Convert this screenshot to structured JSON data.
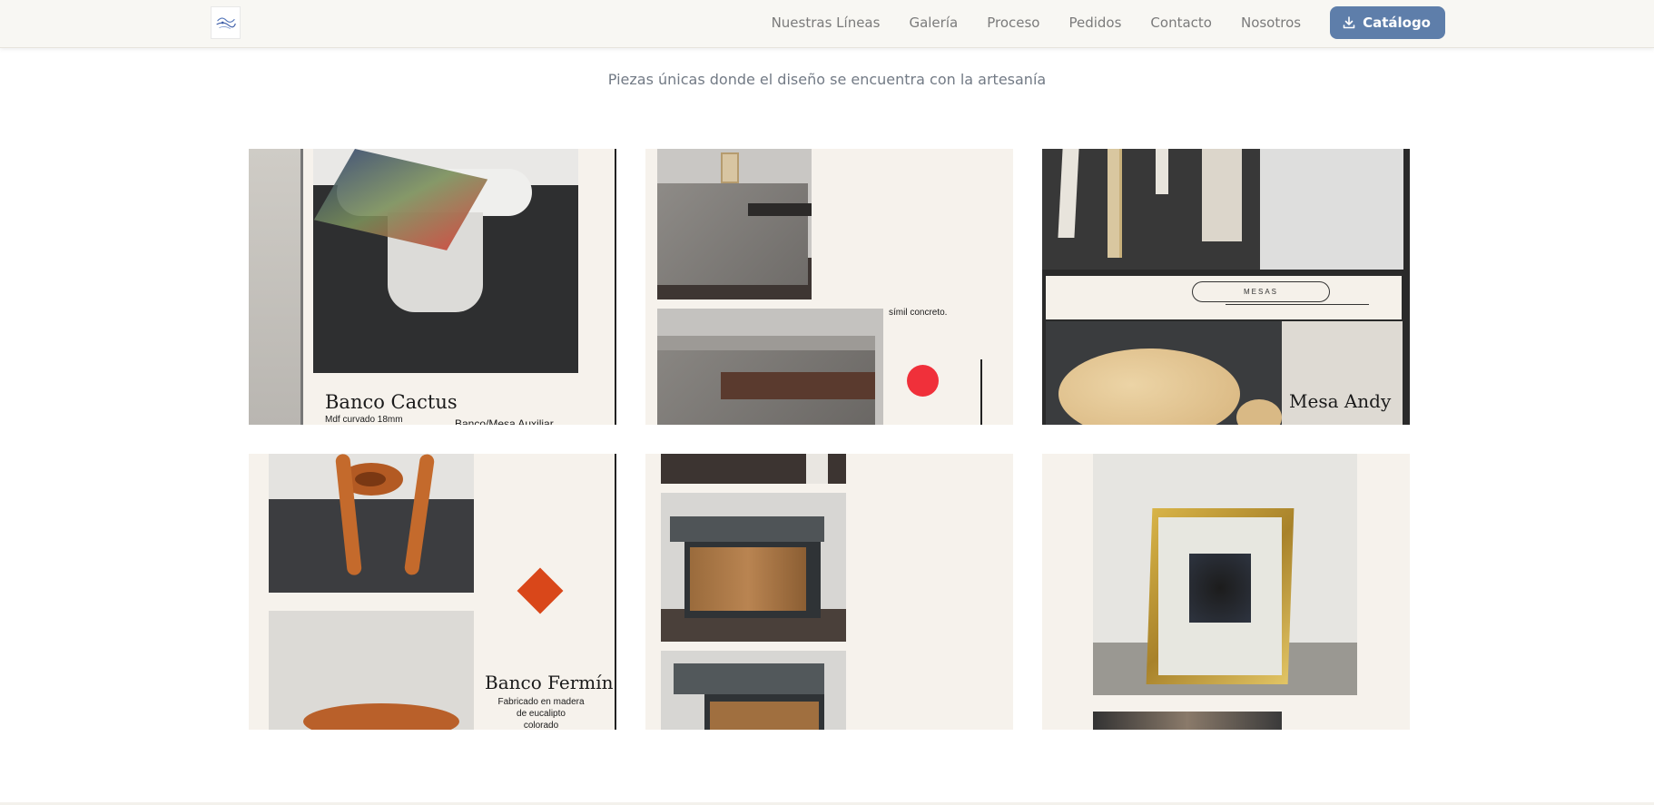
{
  "header": {
    "nav": [
      {
        "label": "Nuestras Líneas"
      },
      {
        "label": "Galería"
      },
      {
        "label": "Proceso"
      },
      {
        "label": "Pedidos"
      },
      {
        "label": "Contacto"
      },
      {
        "label": "Nosotros"
      }
    ],
    "catalog_label": "Catálogo"
  },
  "subtitle": "Piezas únicas donde el diseño se encuentra con la artesanía",
  "gallery": {
    "cards": [
      {
        "title": "Banco Cactus",
        "line1": "Mdf curvado 18mm",
        "line2": "Banco/Mesa Auxiliar"
      },
      {
        "caption": "símil concreto."
      },
      {
        "pill": "MESAS",
        "title": "Mesa Andy"
      },
      {
        "title": "Banco Fermín",
        "line1": "Fabricado en madera",
        "line2": "de eucalipto",
        "line3": "colorado"
      },
      {},
      {}
    ]
  },
  "colors": {
    "accent": "#5e7eaa",
    "card_bg": "#f6f2ec",
    "red_dot": "#f0303a",
    "orange_diamond": "#d9471a"
  }
}
